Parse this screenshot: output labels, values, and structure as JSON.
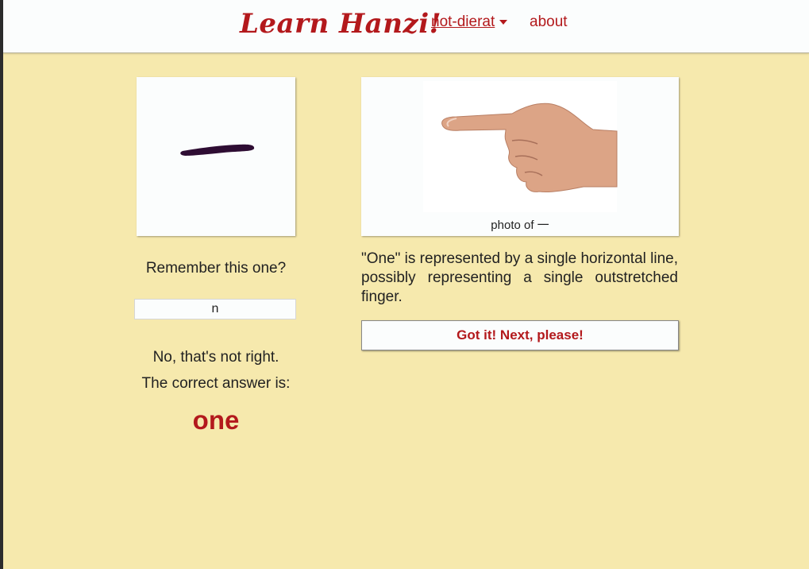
{
  "header": {
    "logo": "Learn Hanzi!",
    "user_menu": "not-dierat",
    "about": "about"
  },
  "quiz": {
    "character_icon": "hanzi-one-brush-stroke",
    "prompt": "Remember this one?",
    "input_value": "n",
    "feedback": "No, that's not right.",
    "correct_label": "The correct answer is:",
    "correct_answer": "one"
  },
  "explanation": {
    "photo_icon": "pointing-hand-photo",
    "photo_caption": "photo of 一",
    "text": "\"One\" is represented by a single horizontal line, possibly representing a single outstretched finger.",
    "next_button": "Got it! Next, please!"
  }
}
